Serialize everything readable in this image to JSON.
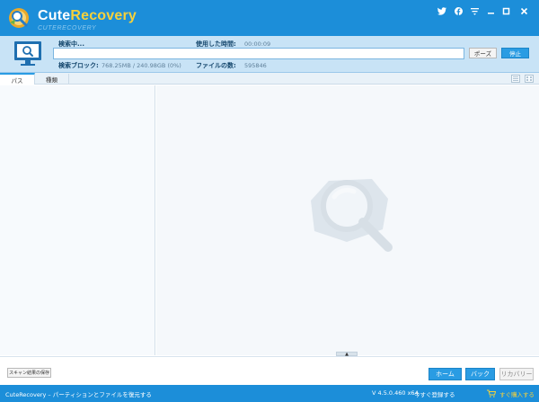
{
  "app": {
    "name_part1": "Cute",
    "name_part2": "Recovery",
    "tagline": "CUTERECOVERY"
  },
  "window_controls": [
    "twitter-icon",
    "facebook-icon",
    "menu-icon",
    "minimize-icon",
    "maximize-icon",
    "close-icon"
  ],
  "scan": {
    "status_label": "検索中...",
    "elapsed_label": "使用した時間:",
    "elapsed_value": "00:00:09",
    "block_label": "検索ブロック:",
    "block_value": "768.25MB / 240.98GB (0%)",
    "files_label": "ファイルの数:",
    "files_value": "595846",
    "progress_percent": 0,
    "pause_label": "ポーズ",
    "stop_label": "停止"
  },
  "tabs": [
    {
      "label": "パス",
      "active": true
    },
    {
      "label": "種類",
      "active": false
    }
  ],
  "actions": {
    "save_scan_label": "スキャン結果の保存",
    "home_label": "ホーム",
    "back_label": "バック",
    "recover_label": "リカバリー"
  },
  "status": {
    "description": "CuteRecovery – パーティションとファイルを復元する",
    "version": "V 4.5.0.460 x64",
    "register": "今すぐ登録する",
    "buy": "すぐ購入する"
  },
  "colors": {
    "primary": "#1c8ed9",
    "accent": "#f6d13a",
    "panel": "#c8e3f6",
    "button_blue": "#2a9ce3"
  }
}
